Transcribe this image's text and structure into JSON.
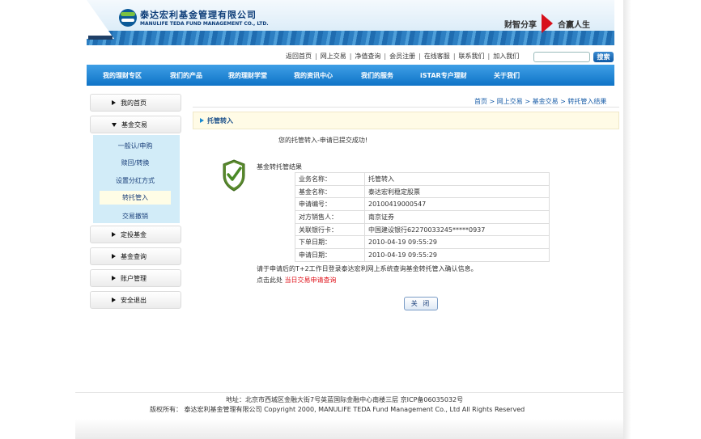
{
  "banner": {
    "company_cn": "泰达宏利基金管理有限公司",
    "company_en": "MANULIFE TEDA FUND MANAGEMENT CO., LTD.",
    "slogan_left": "财智分享",
    "slogan_right": "合赢人生",
    "arrow_color": "#d7101b"
  },
  "toplinks": [
    "返回首页",
    "网上交易",
    "净值查询",
    "会员注册",
    "在线客服",
    "联系我们",
    "加入我们"
  ],
  "search": {
    "placeholder": "",
    "button_label": "搜索"
  },
  "nav": [
    "我的理财专区",
    "我们的产品",
    "我的理财学堂",
    "我的资讯中心",
    "我们的服务",
    "iSTAR专户理财",
    "关于我们"
  ],
  "sidebar": {
    "home": "我的首页",
    "fund_trade": "基金交易",
    "sub_items": [
      "一般认/申购",
      "赎回/转换",
      "设置分红方式",
      "转托管入",
      "交易撤销"
    ],
    "active_sub": "转托管入",
    "fixed_invest": "定投基金",
    "fund_query": "基金查询",
    "account": "账户管理",
    "logout": "安全退出"
  },
  "breadcrumb": [
    "首页",
    "网上交易",
    "基金交易",
    "转托管入结果"
  ],
  "section_title": "托管转入",
  "success_message": "您的托管转入-申请已提交成功!",
  "result": {
    "title": "基金转托管结果",
    "rows": [
      {
        "label": "业务名称：",
        "value": "托管转入"
      },
      {
        "label": "基金名称：",
        "value": "泰达宏利稳定股票"
      },
      {
        "label": "申请编号：",
        "value": "20100419000547"
      },
      {
        "label": "对方销售人：",
        "value": "南京证券"
      },
      {
        "label": "关联银行卡：",
        "value": "中国建设银行62270033245*****0937"
      },
      {
        "label": "下单日期：",
        "value": "2010-04-19 09:55:29"
      },
      {
        "label": "申请日期：",
        "value": "2010-04-19 09:55:29"
      }
    ]
  },
  "note": "请于申请后的T+2工作日登录泰达宏利网上系统查询基金转托管入确认信息。",
  "query_prefix": "点击此处",
  "query_link": "当日交易申请查询",
  "close_label": "关 闭",
  "footer": {
    "address": "地址：北京市西城区金融大街7号英蓝国际金融中心南楼三层  京ICP备06035032号",
    "copyright": "版权所有：  泰达宏利基金管理有限公司 Copyright 2000, MANULIFE TEDA Fund Management Co., Ltd All Rights Reserved"
  },
  "colors": {
    "nav_blue": "#0f74c7",
    "link_blue": "#1a5ea8",
    "alert_red": "#e0141c",
    "submenu_bg": "#d2ecf8"
  }
}
